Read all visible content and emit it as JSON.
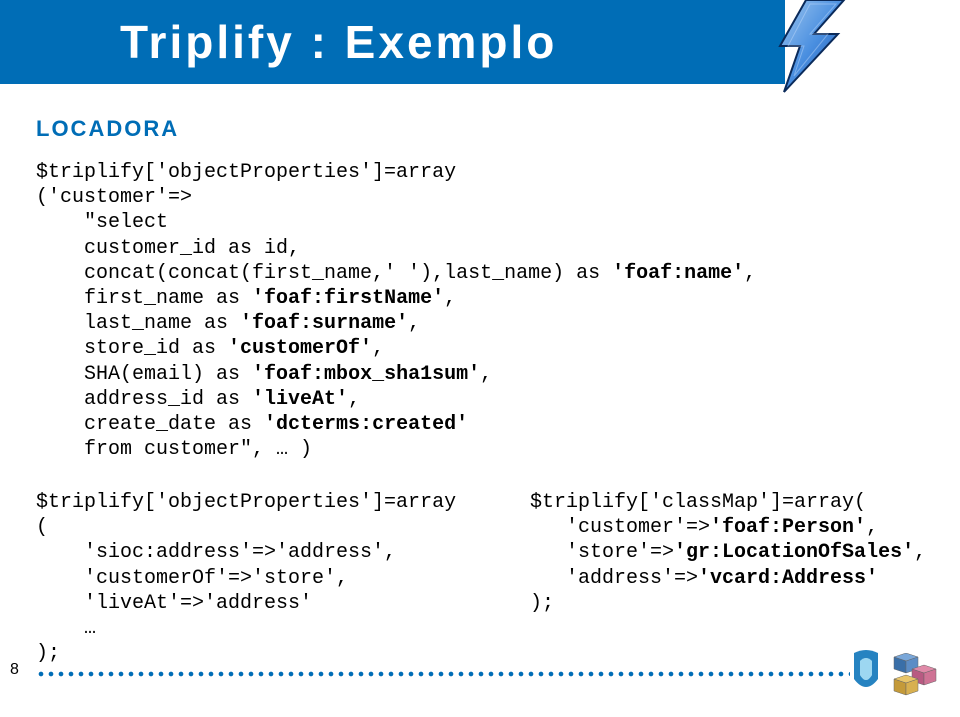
{
  "title": "Triplify : Exemplo",
  "section": "LOCADORA",
  "page_number": "8",
  "code_main": {
    "l0": "$triplify['objectProperties']=array",
    "l1": "('customer'=>",
    "l2": "    \"select",
    "l3": "    customer_id as id,",
    "l4": "    concat(concat(first_name,' '),last_name) as ",
    "l4b": "'foaf:name'",
    "l5": "    first_name as ",
    "l5b": "'foaf:firstName'",
    "l6": "    last_name as ",
    "l6b": "'foaf:surname'",
    "l7": "    store_id as ",
    "l7b": "'customerOf'",
    "l8": "    SHA(email) as ",
    "l8b": "'foaf:mbox_sha1sum'",
    "l9": "    address_id as ",
    "l9b": "'liveAt'",
    "l10": "    create_date as ",
    "l10b": "'dcterms:created'",
    "l11": "    from customer\", … )",
    "comma": ",",
    "quote": "\""
  },
  "code_left": {
    "l0": "$triplify['objectProperties']=array",
    "l1": "(",
    "l2": "    'sioc:address'=>'address',",
    "l3": "    'customerOf'=>'store',",
    "l4": "    'liveAt'=>'address'",
    "l5": "    …",
    "l6": ");"
  },
  "code_right": {
    "l0": "$triplify['classMap']=array(",
    "l1": "   'customer'=>",
    "l1b": "'foaf:Person'",
    "l2": "   'store'=>",
    "l2b": "'gr:LocationOfSales'",
    "l3": "   'address'=>",
    "l3b": "'vcard:Address'",
    "l4": ");",
    "comma": ","
  },
  "colors": {
    "brand": "#006db6"
  }
}
